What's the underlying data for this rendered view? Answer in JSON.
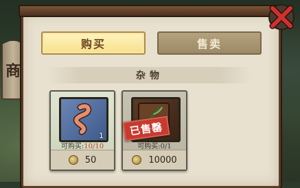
{
  "shop": {
    "sign": "商"
  },
  "tabs": {
    "buy": "购买",
    "sell": "售卖"
  },
  "section": {
    "title": "杂物"
  },
  "items": [
    {
      "icon": "worm-icon",
      "quantity": "1",
      "limit_label": "可购买:",
      "limit_value": "10/10",
      "price": "50",
      "sold": false
    },
    {
      "icon": "quill-book-icon",
      "quantity": "",
      "limit_label": "可购买:",
      "limit_value": "0/1",
      "price": "10000",
      "sold": true,
      "sold_label": "已售罄"
    }
  ],
  "colors": {
    "accent_tab": "#f6e08a",
    "sold_red": "#c83a2e",
    "close_red": "#d0312d"
  }
}
